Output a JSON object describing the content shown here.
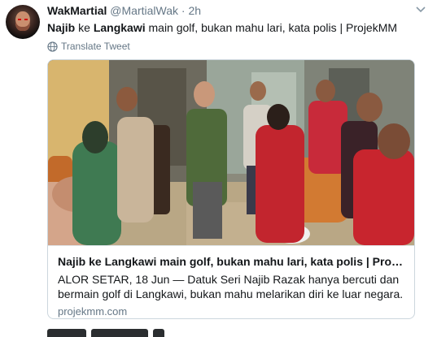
{
  "author": {
    "name": "WakMartial",
    "handle": "@MartialWak",
    "separator": "·",
    "time": "2h"
  },
  "tweet": {
    "word1": "Najib",
    "word2": " ke ",
    "word3": "Langkawi",
    "word4": " main golf, bukan mahu lari, kata polis | ProjekMM"
  },
  "translate_label": "Translate Tweet",
  "card": {
    "title": "Najib ke Langkawi main golf, bukan mahu lari, kata polis | Proje...",
    "description": "ALOR SETAR, 18 Jun — Datuk Seri Najib Razak hanya bercuti dan bermain golf di Langkawi, bukan mahu melarikan diri ke luar negara. “B...",
    "domain": "projekmm.com"
  },
  "icons": {
    "menu": "chevron-down-icon",
    "translate": "globe-icon"
  },
  "colors": {
    "link": "#1da1f2",
    "muted": "#657786",
    "text": "#14171a",
    "border": "#ccd6dd"
  }
}
